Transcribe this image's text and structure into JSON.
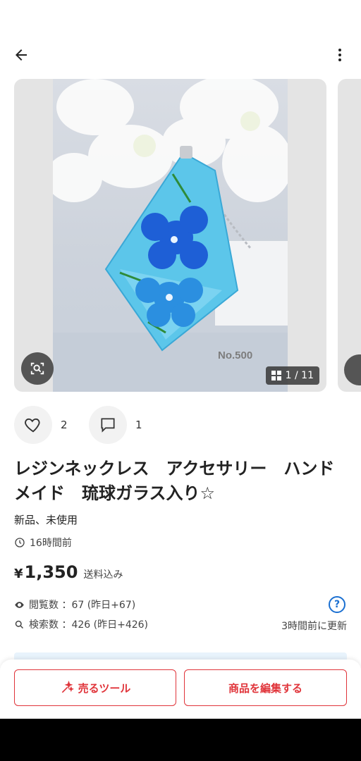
{
  "header": {
    "back_icon": "arrow-left-icon",
    "more_icon": "more-vertical-icon"
  },
  "gallery": {
    "watermark": "No.500",
    "counter": "1 / 11",
    "counter_icon": "grid-icon",
    "lens_icon": "image-search-icon"
  },
  "social": {
    "likes": "2",
    "comments": "1"
  },
  "item": {
    "title": "レジンネックレス　アクセサリー　ハンドメイド　琉球ガラス入り☆",
    "condition": "新品、未使用",
    "posted": "16時間前",
    "price_symbol": "¥",
    "price": "1,350",
    "shipping": "送料込み"
  },
  "stats": {
    "views": "閲覧数 ：67 (昨日+67)",
    "searches": "検索数 ：426 (昨日+426)",
    "updated": "3時間前に更新",
    "help": "?"
  },
  "actions": {
    "sell_tools": "売るツール",
    "edit_item": "商品を編集する"
  },
  "colors": {
    "accent": "#e0343a",
    "link": "#1a6fd1",
    "banner": "#e8f3fc"
  }
}
